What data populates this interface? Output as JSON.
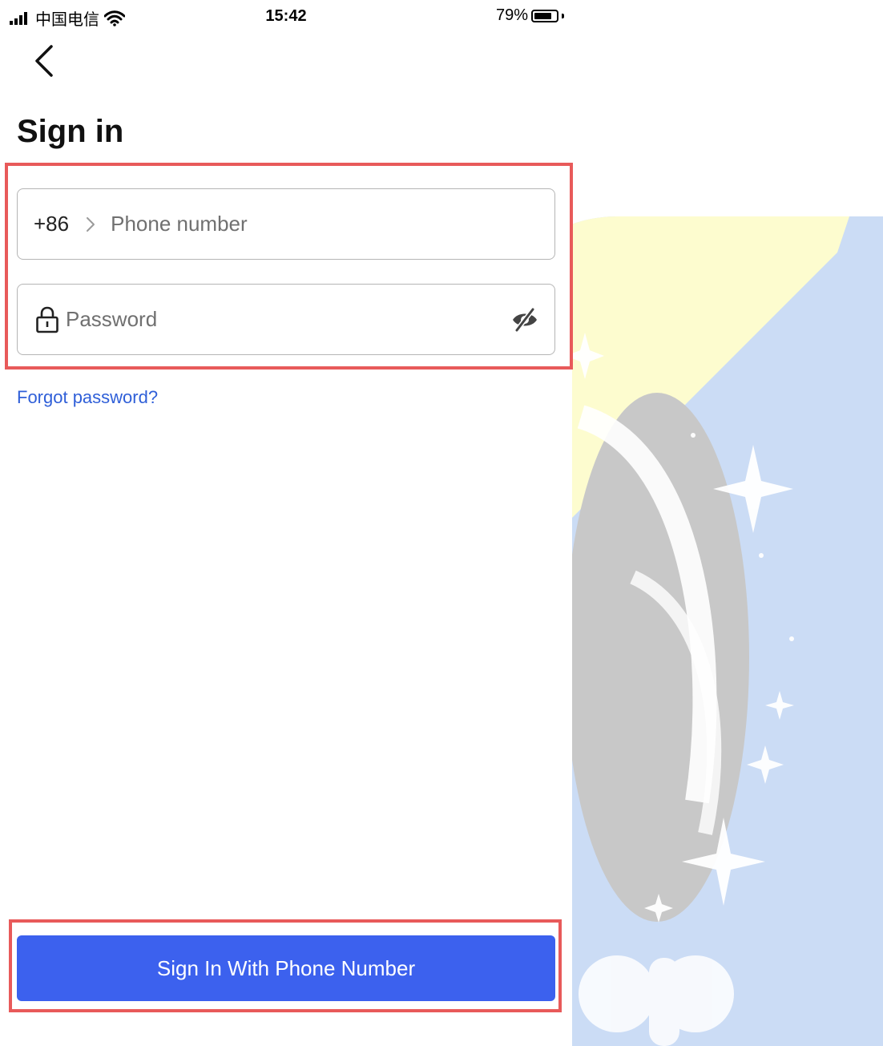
{
  "status_bar": {
    "carrier": "中国电信",
    "time": "15:42",
    "battery_percent": "79%",
    "battery_level": 0.79
  },
  "header": {
    "back_icon": "chevron-left-icon",
    "title": "Sign in"
  },
  "form": {
    "country_code": "+86",
    "phone_placeholder": "Phone number",
    "password_placeholder": "Password",
    "lock_icon": "lock-icon",
    "visibility_icon": "eye-off-icon",
    "forgot_password": "Forgot password?"
  },
  "actions": {
    "submit_label": "Sign In With Phone Number"
  },
  "colors": {
    "primary": "#3c61ee",
    "link": "#2f5fd8",
    "highlight": "#e85a5a"
  }
}
